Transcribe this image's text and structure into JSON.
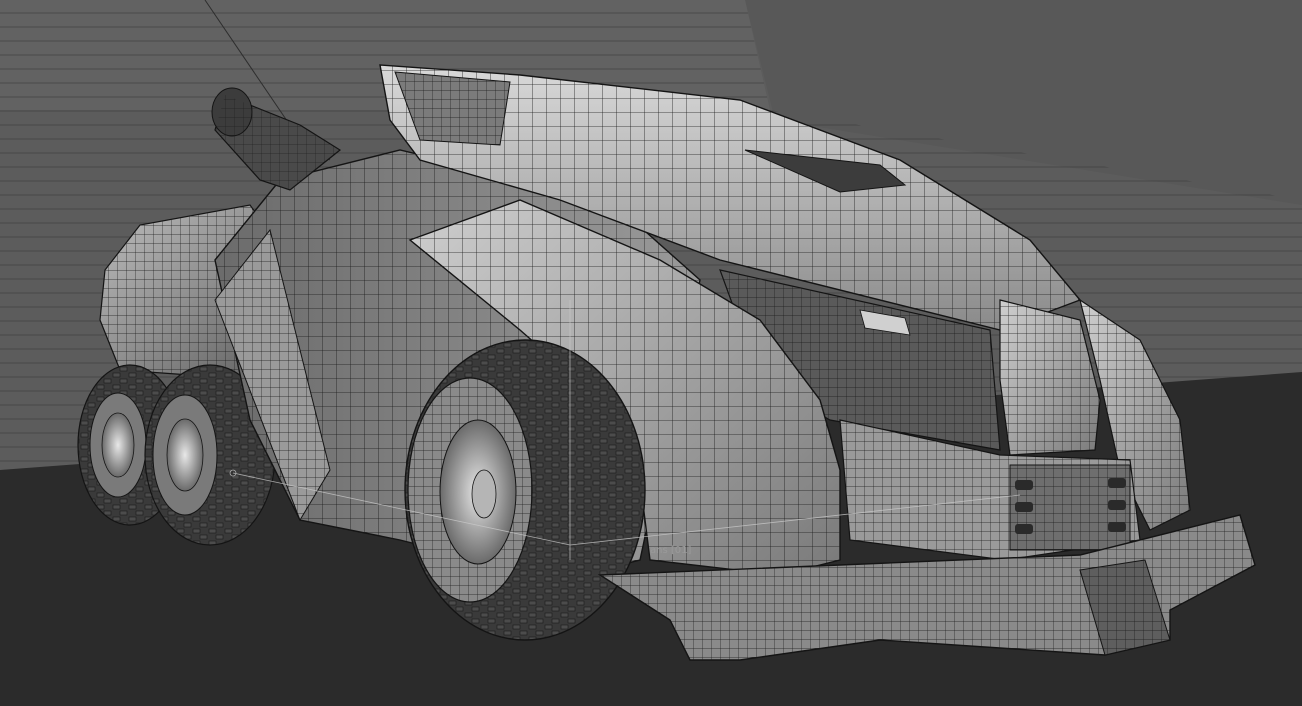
{
  "viewport": {
    "object_label": "ans [01]",
    "colors": {
      "backdrop": "#585858",
      "floor": "#2b2b2b",
      "wire": "#141414",
      "body": "#8c8c8c",
      "highlight": "#d8d8d8",
      "tire": "#3a3a3a"
    }
  }
}
